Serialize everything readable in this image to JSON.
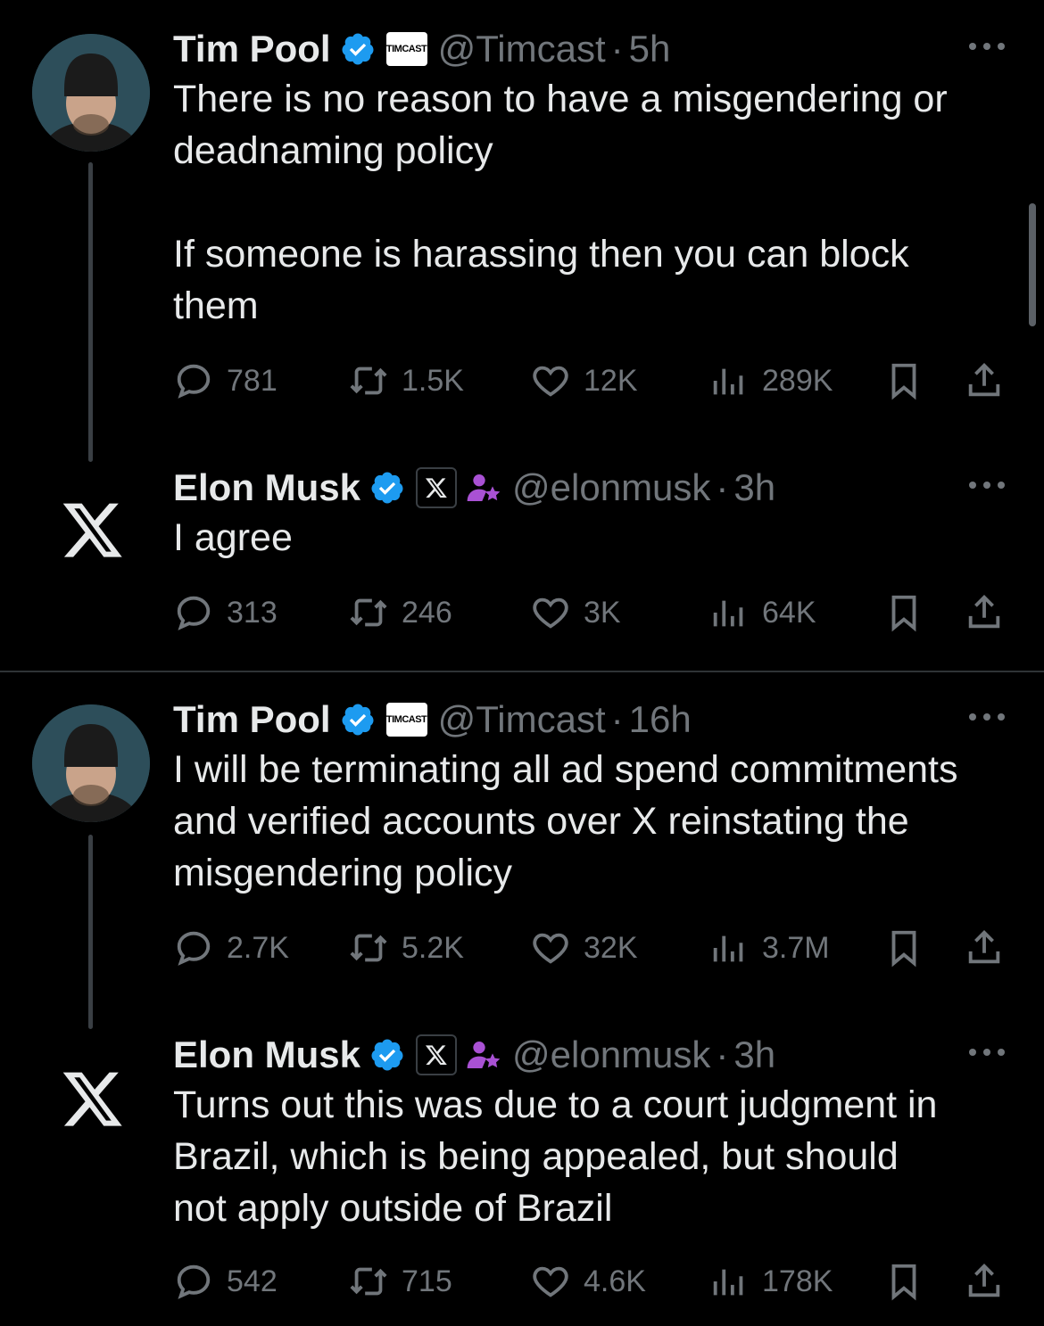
{
  "colors": {
    "verified": "#1d9bf0",
    "muted": "#71767b",
    "text": "#e7e9ea",
    "purple": "#a951d4"
  },
  "tweets": [
    {
      "name": "Tim Pool",
      "badge": "TIMCAST",
      "handle": "@Timcast",
      "dot": "·",
      "time": "5h",
      "text": "There is no reason to have a misgendering or\ndeadnaming policy\n\nIf someone is harassing then you can block\nthem",
      "replies": "781",
      "reposts": "1.5K",
      "likes": "12K",
      "views": "289K"
    },
    {
      "name": "Elon Musk",
      "badge": "X",
      "handle": "@elonmusk",
      "dot": "·",
      "time": "3h",
      "text": "I agree",
      "replies": "313",
      "reposts": "246",
      "likes": "3K",
      "views": "64K"
    },
    {
      "name": "Tim Pool",
      "badge": "TIMCAST",
      "handle": "@Timcast",
      "dot": "·",
      "time": "16h",
      "text": "I will be terminating all ad spend commitments\nand verified accounts over X reinstating the\nmisgendering policy",
      "replies": "2.7K",
      "reposts": "5.2K",
      "likes": "32K",
      "views": "3.7M"
    },
    {
      "name": "Elon Musk",
      "badge": "X",
      "handle": "@elonmusk",
      "dot": "·",
      "time": "3h",
      "text": "Turns out this was due to a court judgment in\nBrazil, which is being appealed, but should\nnot apply outside of Brazil",
      "replies": "542",
      "reposts": "715",
      "likes": "4.6K",
      "views": "178K"
    }
  ]
}
